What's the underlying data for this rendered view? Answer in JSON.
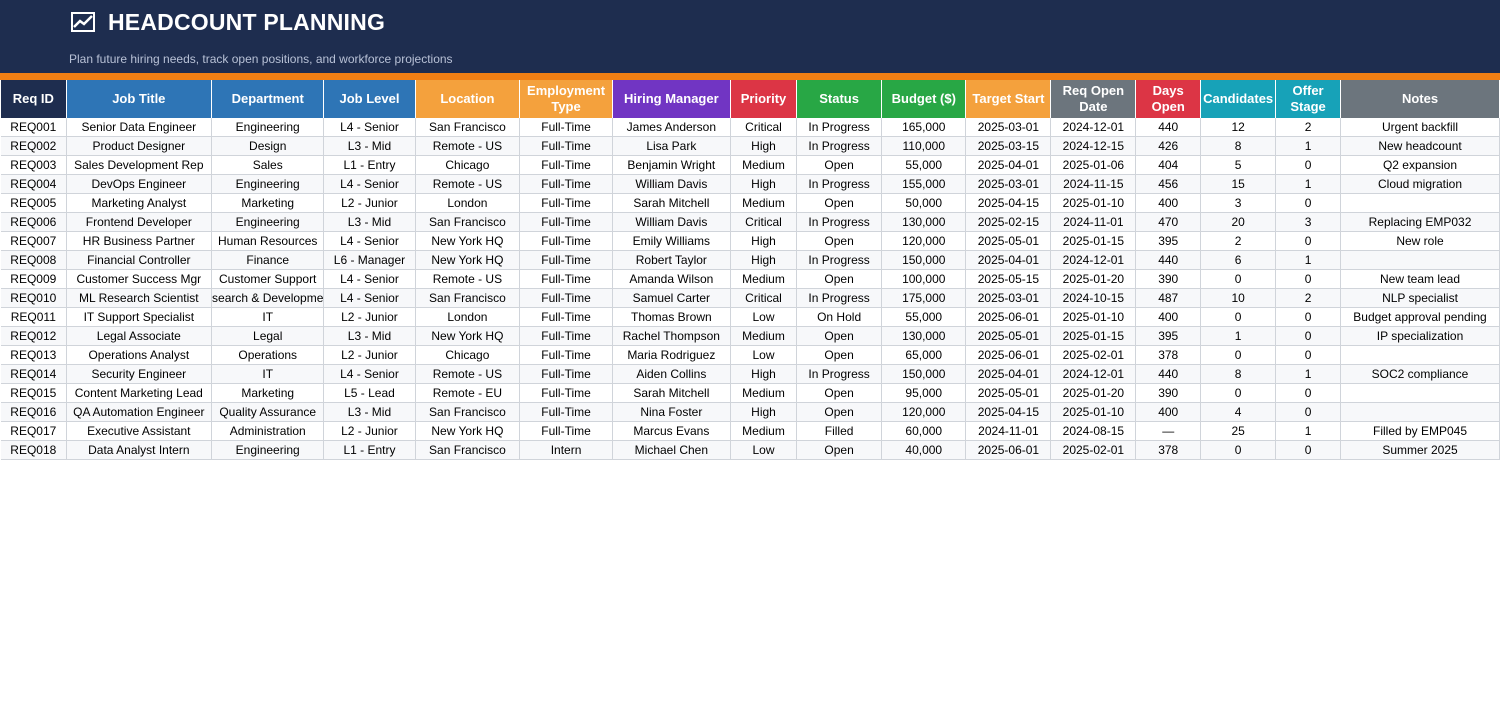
{
  "banner": {
    "icon": "line-chart-icon",
    "title": "HEADCOUNT PLANNING",
    "subtitle": "Plan future hiring needs, track open positions, and workforce projections"
  },
  "colors": {
    "banner": "#1e2d4f",
    "accent": "#f07f14"
  },
  "table": {
    "columns": [
      {
        "label": "Req ID",
        "color": "#1e2d4f"
      },
      {
        "label": "Job Title",
        "color": "#2e75b6"
      },
      {
        "label": "Department",
        "color": "#2e75b6"
      },
      {
        "label": "Job Level",
        "color": "#2e75b6"
      },
      {
        "label": "Location",
        "color": "#f4a13d"
      },
      {
        "label": "Employment Type",
        "color": "#f4a13d"
      },
      {
        "label": "Hiring Manager",
        "color": "#7135c3"
      },
      {
        "label": "Priority",
        "color": "#dc3545"
      },
      {
        "label": "Status",
        "color": "#28a745"
      },
      {
        "label": "Budget ($)",
        "color": "#28a745"
      },
      {
        "label": "Target Start",
        "color": "#f4a13d"
      },
      {
        "label": "Req Open Date",
        "color": "#6c757d"
      },
      {
        "label": "Days Open",
        "color": "#dc3545"
      },
      {
        "label": "Candidates",
        "color": "#17a2b8"
      },
      {
        "label": "Offer Stage",
        "color": "#17a2b8"
      },
      {
        "label": "Notes",
        "color": "#6c757d"
      }
    ],
    "rows": [
      [
        "REQ001",
        "Senior Data Engineer",
        "Engineering",
        "L4 - Senior",
        "San Francisco",
        "Full-Time",
        "James Anderson",
        "Critical",
        "In Progress",
        "165,000",
        "2025-03-01",
        "2024-12-01",
        "440",
        "12",
        "2",
        "Urgent backfill"
      ],
      [
        "REQ002",
        "Product Designer",
        "Design",
        "L3 - Mid",
        "Remote - US",
        "Full-Time",
        "Lisa Park",
        "High",
        "In Progress",
        "110,000",
        "2025-03-15",
        "2024-12-15",
        "426",
        "8",
        "1",
        "New headcount"
      ],
      [
        "REQ003",
        "Sales Development Rep",
        "Sales",
        "L1 - Entry",
        "Chicago",
        "Full-Time",
        "Benjamin Wright",
        "Medium",
        "Open",
        "55,000",
        "2025-04-01",
        "2025-01-06",
        "404",
        "5",
        "0",
        "Q2 expansion"
      ],
      [
        "REQ004",
        "DevOps Engineer",
        "Engineering",
        "L4 - Senior",
        "Remote - US",
        "Full-Time",
        "William Davis",
        "High",
        "In Progress",
        "155,000",
        "2025-03-01",
        "2024-11-15",
        "456",
        "15",
        "1",
        "Cloud migration"
      ],
      [
        "REQ005",
        "Marketing Analyst",
        "Marketing",
        "L2 - Junior",
        "London",
        "Full-Time",
        "Sarah Mitchell",
        "Medium",
        "Open",
        "50,000",
        "2025-04-15",
        "2025-01-10",
        "400",
        "3",
        "0",
        ""
      ],
      [
        "REQ006",
        "Frontend Developer",
        "Engineering",
        "L3 - Mid",
        "San Francisco",
        "Full-Time",
        "William Davis",
        "Critical",
        "In Progress",
        "130,000",
        "2025-02-15",
        "2024-11-01",
        "470",
        "20",
        "3",
        "Replacing EMP032"
      ],
      [
        "REQ007",
        "HR Business Partner",
        "Human Resources",
        "L4 - Senior",
        "New York HQ",
        "Full-Time",
        "Emily Williams",
        "High",
        "Open",
        "120,000",
        "2025-05-01",
        "2025-01-15",
        "395",
        "2",
        "0",
        "New role"
      ],
      [
        "REQ008",
        "Financial Controller",
        "Finance",
        "L6 - Manager",
        "New York HQ",
        "Full-Time",
        "Robert Taylor",
        "High",
        "In Progress",
        "150,000",
        "2025-04-01",
        "2024-12-01",
        "440",
        "6",
        "1",
        ""
      ],
      [
        "REQ009",
        "Customer Success Mgr",
        "Customer Support",
        "L4 - Senior",
        "Remote - US",
        "Full-Time",
        "Amanda Wilson",
        "Medium",
        "Open",
        "100,000",
        "2025-05-15",
        "2025-01-20",
        "390",
        "0",
        "0",
        "New team lead"
      ],
      [
        "REQ010",
        "ML Research Scientist",
        "search & Developme",
        "L4 - Senior",
        "San Francisco",
        "Full-Time",
        "Samuel Carter",
        "Critical",
        "In Progress",
        "175,000",
        "2025-03-01",
        "2024-10-15",
        "487",
        "10",
        "2",
        "NLP specialist"
      ],
      [
        "REQ011",
        "IT Support Specialist",
        "IT",
        "L2 - Junior",
        "London",
        "Full-Time",
        "Thomas Brown",
        "Low",
        "On Hold",
        "55,000",
        "2025-06-01",
        "2025-01-10",
        "400",
        "0",
        "0",
        "Budget approval pending"
      ],
      [
        "REQ012",
        "Legal Associate",
        "Legal",
        "L3 - Mid",
        "New York HQ",
        "Full-Time",
        "Rachel Thompson",
        "Medium",
        "Open",
        "130,000",
        "2025-05-01",
        "2025-01-15",
        "395",
        "1",
        "0",
        "IP specialization"
      ],
      [
        "REQ013",
        "Operations Analyst",
        "Operations",
        "L2 - Junior",
        "Chicago",
        "Full-Time",
        "Maria Rodriguez",
        "Low",
        "Open",
        "65,000",
        "2025-06-01",
        "2025-02-01",
        "378",
        "0",
        "0",
        ""
      ],
      [
        "REQ014",
        "Security Engineer",
        "IT",
        "L4 - Senior",
        "Remote - US",
        "Full-Time",
        "Aiden Collins",
        "High",
        "In Progress",
        "150,000",
        "2025-04-01",
        "2024-12-01",
        "440",
        "8",
        "1",
        "SOC2 compliance"
      ],
      [
        "REQ015",
        "Content Marketing Lead",
        "Marketing",
        "L5 - Lead",
        "Remote - EU",
        "Full-Time",
        "Sarah Mitchell",
        "Medium",
        "Open",
        "95,000",
        "2025-05-01",
        "2025-01-20",
        "390",
        "0",
        "0",
        ""
      ],
      [
        "REQ016",
        "QA Automation Engineer",
        "Quality Assurance",
        "L3 - Mid",
        "San Francisco",
        "Full-Time",
        "Nina Foster",
        "High",
        "Open",
        "120,000",
        "2025-04-15",
        "2025-01-10",
        "400",
        "4",
        "0",
        ""
      ],
      [
        "REQ017",
        "Executive Assistant",
        "Administration",
        "L2 - Junior",
        "New York HQ",
        "Full-Time",
        "Marcus Evans",
        "Medium",
        "Filled",
        "60,000",
        "2024-11-01",
        "2024-08-15",
        "—",
        "25",
        "1",
        "Filled by EMP045"
      ],
      [
        "REQ018",
        "Data Analyst Intern",
        "Engineering",
        "L1 - Entry",
        "San Francisco",
        "Intern",
        "Michael Chen",
        "Low",
        "Open",
        "40,000",
        "2025-06-01",
        "2025-02-01",
        "378",
        "0",
        "0",
        "Summer 2025"
      ]
    ]
  }
}
